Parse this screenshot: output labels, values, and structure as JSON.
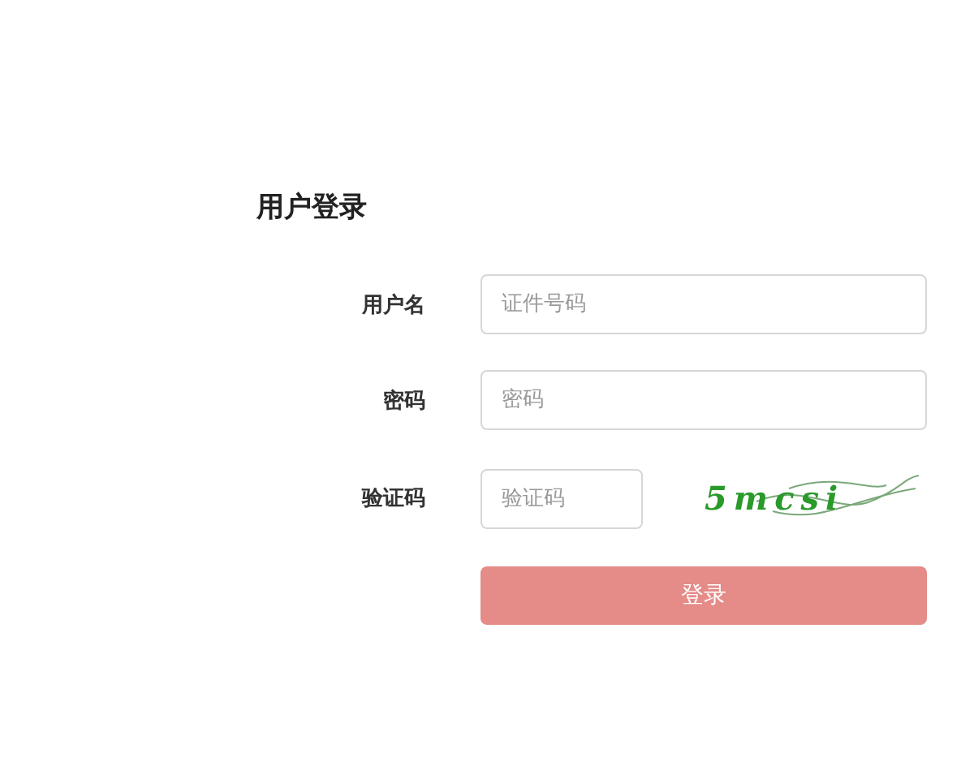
{
  "title": "用户登录",
  "fields": [
    {
      "label": "用户名",
      "placeholder": "证件号码",
      "kind": "text"
    },
    {
      "label": "密码",
      "placeholder": "密码",
      "kind": "text"
    },
    {
      "label": "验证码",
      "placeholder": "验证码",
      "kind": "captcha"
    }
  ],
  "captcha": {
    "text": "5mcsi"
  },
  "submit": {
    "label": "登录"
  }
}
